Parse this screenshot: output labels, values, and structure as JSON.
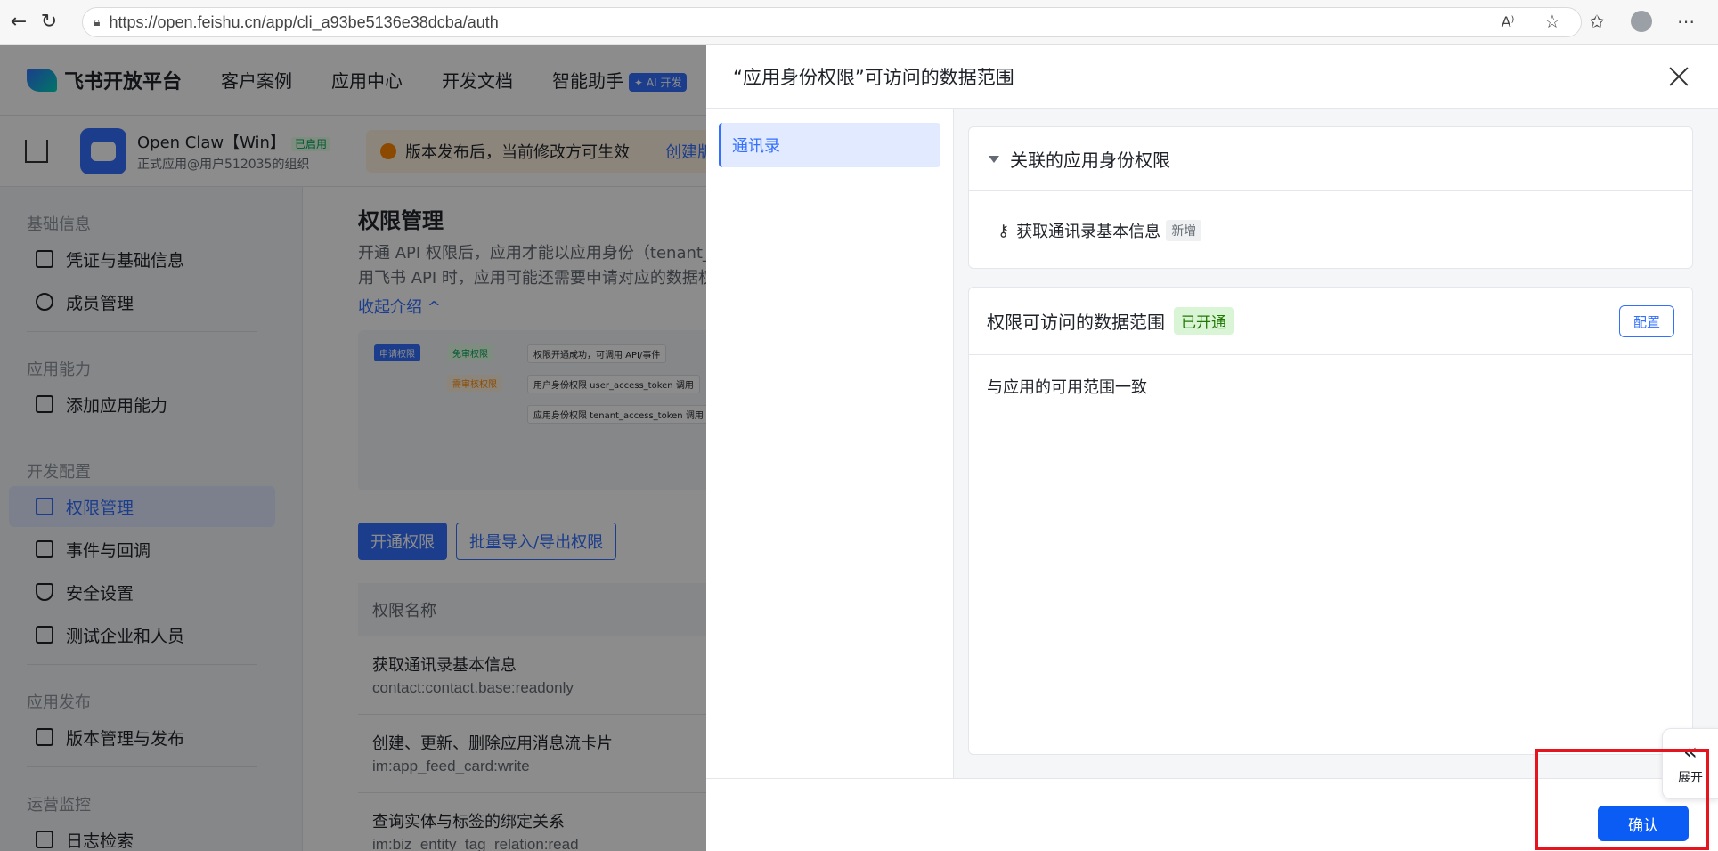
{
  "browser": {
    "url": "https://open.feishu.cn/app/cli_a93be5136e38dcba/auth"
  },
  "topnav": {
    "logo": "飞书开放平台",
    "items": [
      "客户案例",
      "应用中心",
      "开发文档",
      "智能助手"
    ],
    "ai_badge": "✦ AI 开发"
  },
  "app": {
    "name": "Open Claw【Win】",
    "status": "已启用",
    "org": "正式应用@用户512035的组织",
    "notice": "版本发布后，当前修改方可生效",
    "notice_link": "创建版"
  },
  "sidebar": {
    "groups": [
      {
        "label": "基础信息",
        "items": [
          "凭证与基础信息",
          "成员管理"
        ]
      },
      {
        "label": "应用能力",
        "items": [
          "添加应用能力"
        ]
      },
      {
        "label": "开发配置",
        "items": [
          "权限管理",
          "事件与回调",
          "安全设置",
          "测试企业和人员"
        ]
      },
      {
        "label": "应用发布",
        "items": [
          "版本管理与发布"
        ]
      },
      {
        "label": "运营监控",
        "items": [
          "日志检索"
        ]
      }
    ]
  },
  "main": {
    "title": "权限管理",
    "desc1": "开通 API 权限后，应用才能以应用身份（tenant_a",
    "desc2": "用飞书 API 时，应用可能还需要申请对应的数据权",
    "collapse": "收起介绍 ^",
    "diagram": {
      "apply": "申请权限",
      "free": "免审权限",
      "success": "权限开通成功，可调用 API/事件",
      "review": "需审核权限",
      "user_token": "用户身份权限 user_access_token 调用",
      "tenant_token": "应用身份权限 tenant_access_token 调用"
    },
    "btn_open": "开通权限",
    "btn_batch": "批量导入/导出权限",
    "table_header": "权限名称",
    "rows": [
      {
        "name": "获取通讯录基本信息",
        "code": "contact:contact.base:readonly"
      },
      {
        "name": "创建、更新、删除应用消息流卡片",
        "code": "im:app_feed_card:write"
      },
      {
        "name": "查询实体与标签的绑定关系",
        "code": "im:biz_entity_tag_relation:read"
      }
    ]
  },
  "drawer": {
    "title": "“应用身份权限”可访问的数据范围",
    "tab": "通讯录",
    "section1_title": "关联的应用身份权限",
    "permission": "获取通讯录基本信息",
    "new_tag": "新增",
    "section2_title": "权限可访问的数据范围",
    "open_tag": "已开通",
    "config_btn": "配置",
    "scope_text": "与应用的可用范围一致",
    "confirm_btn": "确认",
    "expand_label": "展开"
  }
}
